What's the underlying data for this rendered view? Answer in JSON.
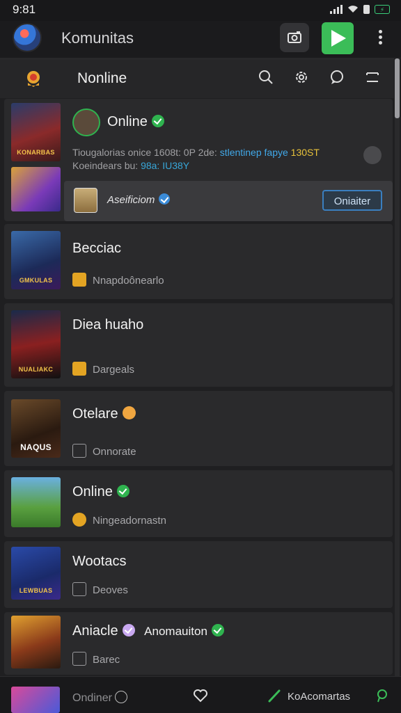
{
  "status_bar": {
    "time": "9:81",
    "battery": "⚡"
  },
  "header": {
    "title": "Komunitas"
  },
  "subheader": {
    "title": "Nonline"
  },
  "featured": {
    "status": "Online",
    "info_prefix": "Tiougalorias  onice 1608t: 0P 2de:",
    "info_highlight": "stlentinep fapye",
    "info_number": "130ST",
    "info_line2_prefix": "Koeindears bu:",
    "info_line2_value": "98a: IU38Y",
    "thumb_texts": [
      "KONARBAS",
      ""
    ],
    "row_label": "Aseificiom",
    "row_button": "Oniaiter"
  },
  "items": [
    {
      "name": "Becciac",
      "subtitle": "Nnapdoônearlo",
      "thumb_text": "GMKULAS"
    },
    {
      "name": "Diea huaho",
      "subtitle": "Dargeals",
      "thumb_text": "NUALIAKC"
    },
    {
      "name": "Otelare",
      "subtitle": "Onnorate",
      "thumb_text": "NAQUS"
    },
    {
      "name": "Online",
      "subtitle": "Ningeadornastn",
      "thumb_text": ""
    },
    {
      "name": "Wootacs",
      "subtitle": "Deoves",
      "thumb_text": "LEWBUAS"
    },
    {
      "name": "Aniacle",
      "name_extra": "Anomauiton",
      "subtitle": "Barec",
      "thumb_text": ""
    }
  ],
  "bottom_nav": {
    "label_left": "Ondiner",
    "label_right": "KoAcomartas"
  },
  "colors": {
    "accent_green": "#3bbd58",
    "accent_blue": "#3a7fc0",
    "highlight_blue": "#41a8e8",
    "highlight_yellow": "#e8c23a"
  }
}
